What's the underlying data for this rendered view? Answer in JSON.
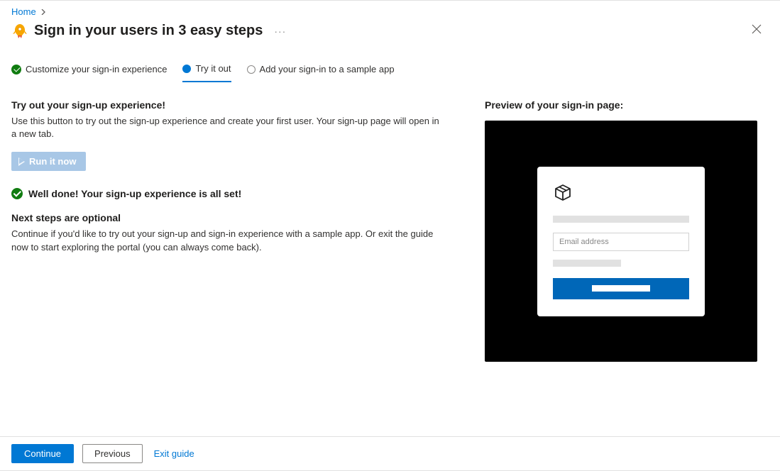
{
  "breadcrumb": {
    "home": "Home"
  },
  "header": {
    "title": "Sign in your users in 3 easy steps"
  },
  "steps": {
    "customize": "Customize your sign-in experience",
    "try": "Try it out",
    "sample": "Add your sign-in to a sample app"
  },
  "main": {
    "heading": "Try out your sign-up experience!",
    "body": "Use this button to try out the sign-up experience and create your first user. Your sign-up page will open in a new tab.",
    "run_button": "Run it now",
    "well_done": "Well done! Your sign-up experience is all set!",
    "next_heading": "Next steps are optional",
    "next_body": "Continue if you'd like to try out your sign-up and sign-in experience with a sample app. Or exit the guide now to start exploring the portal (you can always come back)."
  },
  "preview": {
    "heading": "Preview of your sign-in page:",
    "card": {
      "placeholder": "Email address"
    }
  },
  "footer": {
    "continue": "Continue",
    "previous": "Previous",
    "exit": "Exit guide"
  }
}
